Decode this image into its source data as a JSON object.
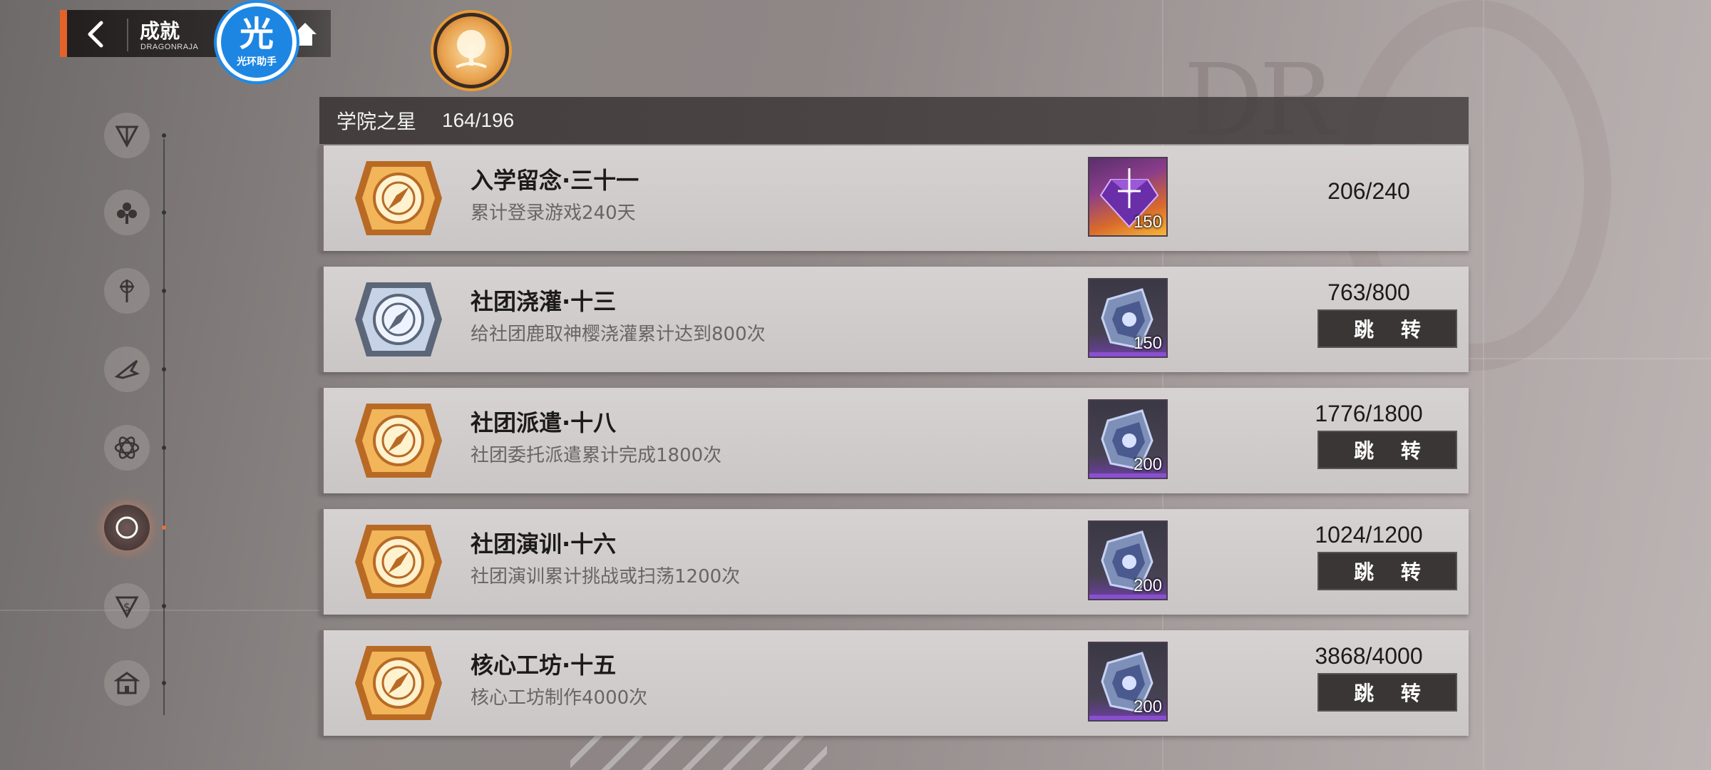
{
  "header": {
    "title": "成就",
    "subtitle": "DRAGONRAJA"
  },
  "overlay_badge": {
    "glyph": "光",
    "label": "光环助手"
  },
  "category": {
    "name": "学院之星",
    "count": "164/196"
  },
  "nav": {
    "items": [
      {
        "name": "nav-item-1",
        "icon": "crest-icon",
        "active": false
      },
      {
        "name": "nav-item-2",
        "icon": "clover-icon",
        "active": false
      },
      {
        "name": "nav-item-3",
        "icon": "sword-icon",
        "active": false
      },
      {
        "name": "nav-item-4",
        "icon": "wing-icon",
        "active": false
      },
      {
        "name": "nav-item-5",
        "icon": "atom-icon",
        "active": false
      },
      {
        "name": "nav-item-6",
        "icon": "compass-icon",
        "active": true
      },
      {
        "name": "nav-item-7",
        "icon": "dollar-crest-icon",
        "active": false
      },
      {
        "name": "nav-item-8",
        "icon": "building-icon",
        "active": false
      }
    ]
  },
  "achievements": [
    {
      "title": "入学留念·三十一",
      "desc": "累计登录游戏240天",
      "badge": "gold",
      "reward_type": "diamond",
      "reward_qty": "150",
      "progress": "206/240",
      "show_jump": false
    },
    {
      "title": "社团浇灌·十三",
      "desc": "给社团鹿取神樱浇灌累计达到800次",
      "badge": "silver",
      "reward_type": "shard",
      "reward_qty": "150",
      "progress": "763/800",
      "show_jump": true
    },
    {
      "title": "社团派遣·十八",
      "desc": "社团委托派遣累计完成1800次",
      "badge": "gold",
      "reward_type": "shard",
      "reward_qty": "200",
      "progress": "1776/1800",
      "show_jump": true
    },
    {
      "title": "社团演训·十六",
      "desc": "社团演训累计挑战或扫荡1200次",
      "badge": "gold",
      "reward_type": "shard",
      "reward_qty": "200",
      "progress": "1024/1200",
      "show_jump": true
    },
    {
      "title": "核心工坊·十五",
      "desc": "核心工坊制作4000次",
      "badge": "gold",
      "reward_type": "shard",
      "reward_qty": "200",
      "progress": "3868/4000",
      "show_jump": true
    }
  ],
  "jump_label": "跳 转",
  "colors": {
    "accent": "#e4622a",
    "badge_gold": "#e9a53c",
    "badge_silver": "#8fa0b8",
    "button_bg": "#3a3636"
  }
}
